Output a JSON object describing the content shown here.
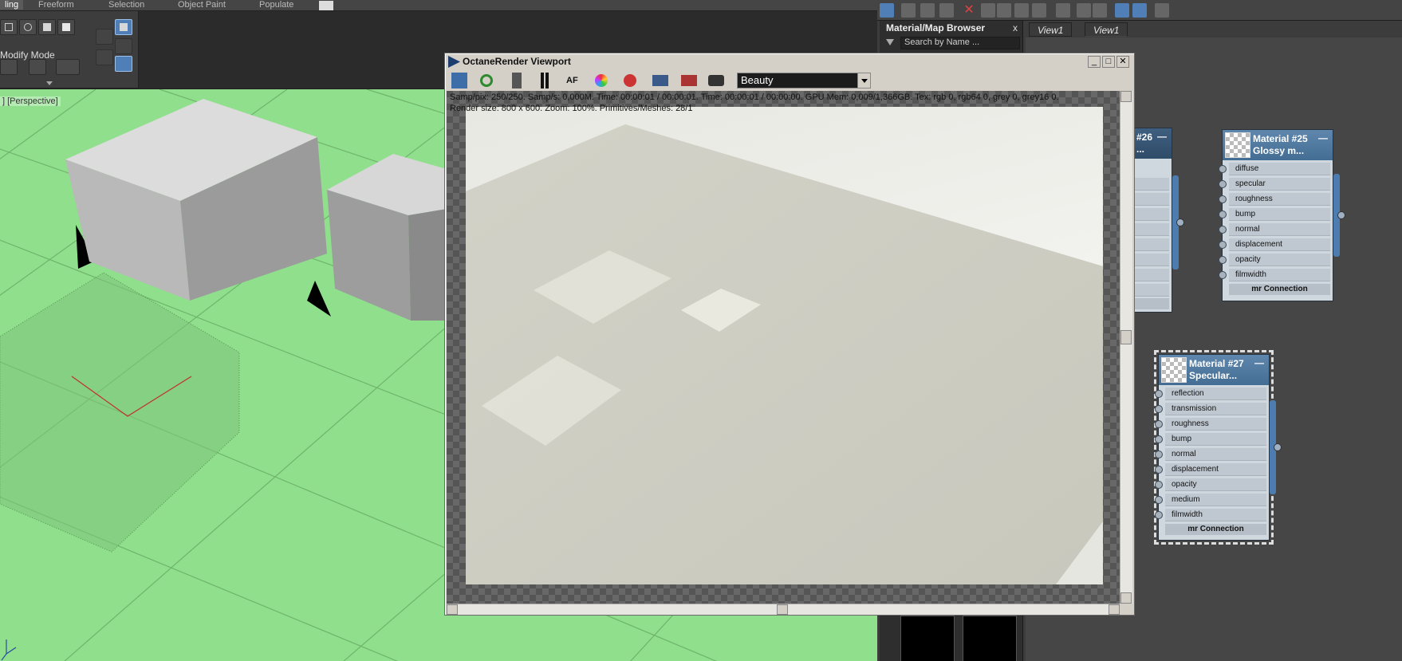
{
  "ribbon": {
    "tabs": [
      "ling",
      "Freeform",
      "Selection",
      "Object Paint",
      "Populate"
    ],
    "modify_mode": "Modify Mode"
  },
  "viewport": {
    "label": "] [Perspective]"
  },
  "octane": {
    "title": "OctaneRender Viewport",
    "pass": "Beauty",
    "stats_line1": "Samp/pix: 250/250.   Samp/s: 0,000M.   Time: 00:00:01 / 00:00:01.   Time: 00:00:01 / 00:00:00.   GPU Mem: 0,009/1,366GB.   Tex: rgb 0, rgb64 0, grey 0, grey16 0.",
    "stats_line2": "Render size: 800 x 600.   Zoom: 100%.   Primitives/Meshes: 28/1",
    "min_glyph": "_",
    "max_glyph": "□",
    "close_glyph": "✕"
  },
  "material_browser": {
    "title": "Material/Map Browser",
    "search_placeholder": "Search by Name ...",
    "close_glyph": "x"
  },
  "view_tabs": [
    "View1",
    "View1"
  ],
  "nodes": {
    "n26": {
      "title_line1": "#26",
      "title_line2": "...",
      "footer_partial": "n",
      "min": "—"
    },
    "n25": {
      "title": "Material #25 Glossy m...",
      "min": "—",
      "slots": [
        "diffuse",
        "specular",
        "roughness",
        "bump",
        "normal",
        "displacement",
        "opacity",
        "filmwidth"
      ],
      "footer": "mr Connection"
    },
    "n27": {
      "title": "Material #27 Specular...",
      "min": "—",
      "slots": [
        "reflection",
        "transmission",
        "roughness",
        "bump",
        "normal",
        "displacement",
        "opacity",
        "medium",
        "filmwidth"
      ],
      "footer": "mr Connection"
    }
  },
  "colors": {
    "viewport_green": "#8fdf8c",
    "node_header": "#4f7aa3",
    "accent_blue": "#4f7fb6"
  }
}
